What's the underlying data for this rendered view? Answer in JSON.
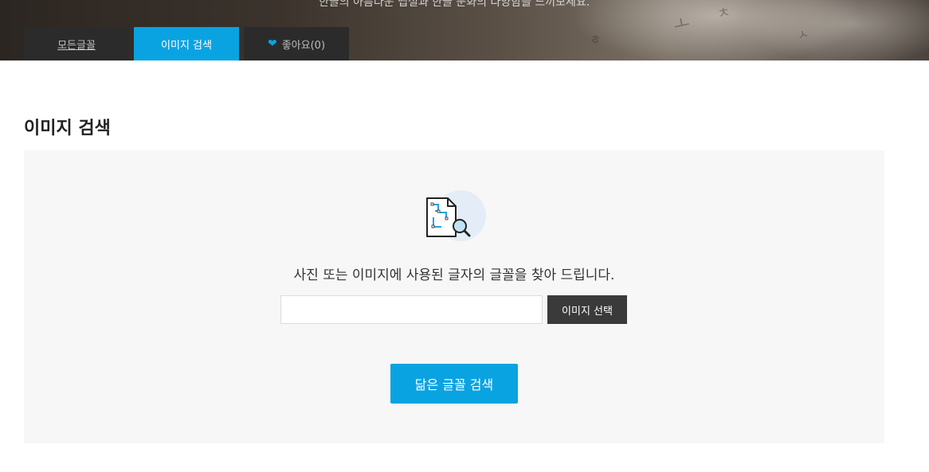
{
  "hero": {
    "tagline": "한글의 아름다운 맵셜과 한글 문화의 다양함을 느끼보세요."
  },
  "tabs": [
    {
      "label": "모든글꼴",
      "active": false
    },
    {
      "label": "이미지 검색",
      "active": true
    },
    {
      "label": "좋아요(0)",
      "active": false,
      "icon": "heart-icon"
    }
  ],
  "page": {
    "title": "이미지 검색"
  },
  "search_panel": {
    "icon": "image-search-icon",
    "description": "사진 또는 이미지에 사용된 글자의 글꼴을 찾아 드립니다.",
    "file_input_value": "",
    "select_button_label": "이미지 선택",
    "search_button_label": "닮은 글꼴 검색"
  },
  "colors": {
    "accent": "#0aa3e2",
    "tab_dark": "#2b2b2b",
    "panel_bg": "#f7f7f7",
    "select_button_bg": "#3a3a3a"
  }
}
